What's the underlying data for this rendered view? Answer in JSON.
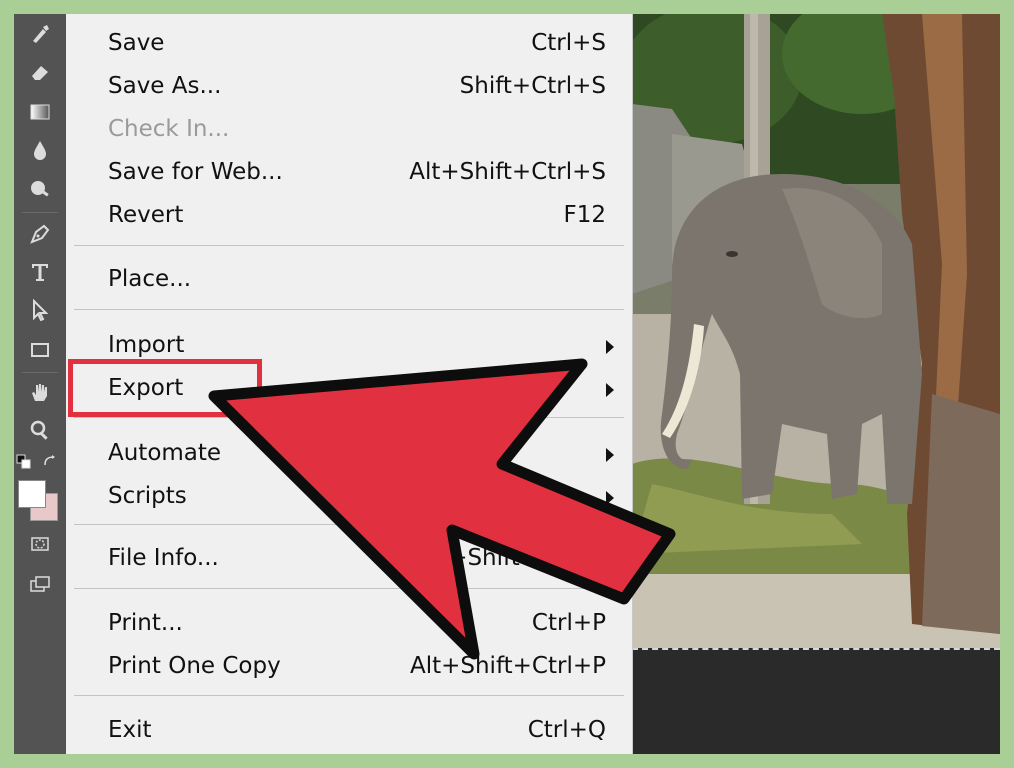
{
  "menu": {
    "items": [
      {
        "label": "Save",
        "shortcut": "Ctrl+S"
      },
      {
        "label": "Save As...",
        "shortcut": "Shift+Ctrl+S"
      },
      {
        "label": "Check In...",
        "shortcut": "",
        "disabled": true
      },
      {
        "label": "Save for Web...",
        "shortcut": "Alt+Shift+Ctrl+S"
      },
      {
        "label": "Revert",
        "shortcut": "F12"
      },
      {
        "label": "Place...",
        "shortcut": ""
      },
      {
        "label": "Import",
        "shortcut": "",
        "submenu": true
      },
      {
        "label": "Export",
        "shortcut": "",
        "submenu": true,
        "highlighted": true
      },
      {
        "label": "Automate",
        "shortcut": "",
        "submenu": true
      },
      {
        "label": "Scripts",
        "shortcut": "",
        "submenu": true
      },
      {
        "label": "File Info...",
        "shortcut": "Alt+Shift+Ctrl+I"
      },
      {
        "label": "Print...",
        "shortcut": "Ctrl+P"
      },
      {
        "label": "Print One Copy",
        "shortcut": "Alt+Shift+Ctrl+P"
      },
      {
        "label": "Exit",
        "shortcut": "Ctrl+Q"
      }
    ]
  },
  "toolbar": {
    "tools": [
      "history-brush-icon",
      "eraser-icon",
      "gradient-icon",
      "blur-icon",
      "dodge-icon",
      "pen-icon",
      "type-icon",
      "path-selection-icon",
      "rectangle-shape-icon",
      "hand-icon",
      "zoom-icon"
    ]
  },
  "colors": {
    "background": "#a9cf97",
    "menu": "#f0f0f0",
    "toolbar": "#535353",
    "annotation": "#e1303f"
  }
}
